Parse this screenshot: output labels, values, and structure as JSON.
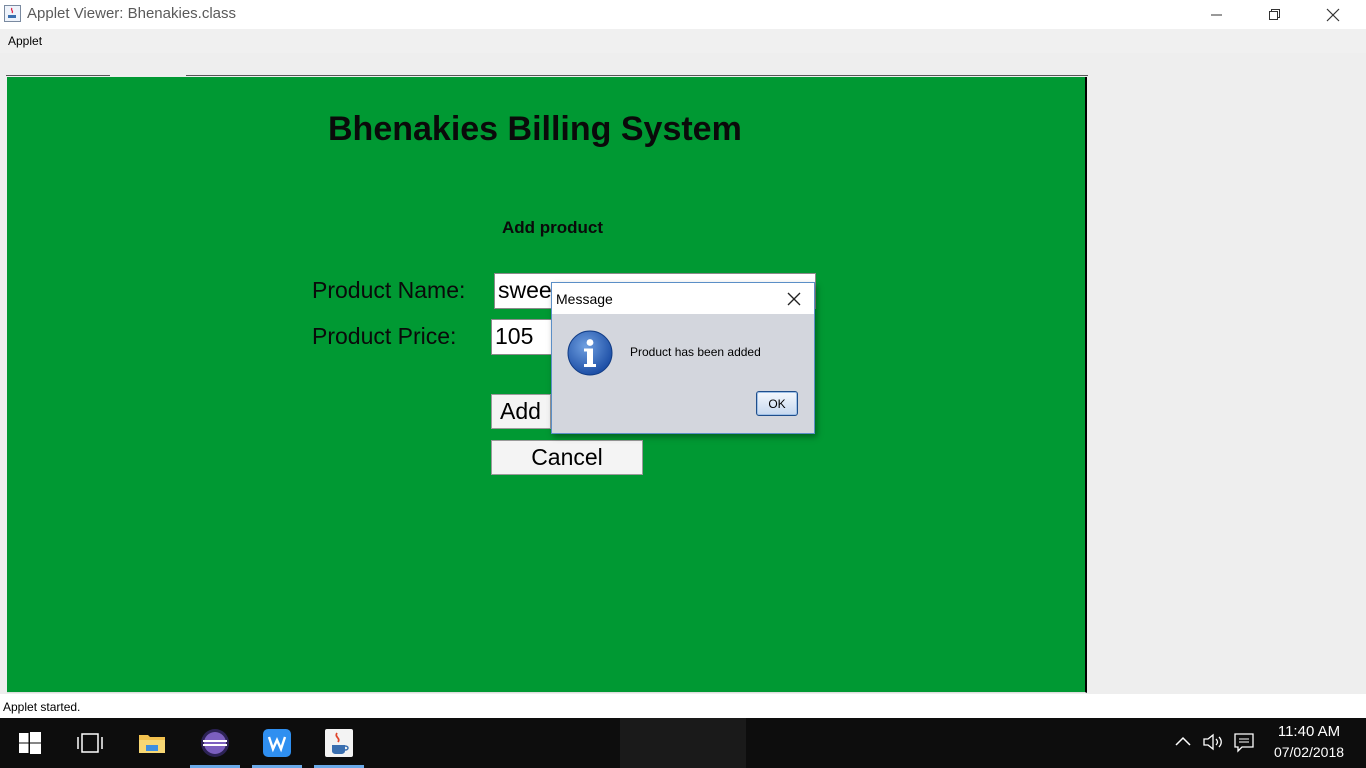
{
  "window": {
    "title": "Applet Viewer: Bhenakies.class",
    "menu": [
      "Applet"
    ]
  },
  "applet": {
    "title": "Bhenakies Billing System",
    "subtitle": "Add product",
    "product_name_label": "Product Name:",
    "product_name_value": "swee",
    "product_price_label": "Product Price:",
    "product_price_value": "105",
    "add_label": "Add",
    "cancel_label": "Cancel",
    "background_color": "#009933"
  },
  "dialog": {
    "title": "Message",
    "message": "Product has been added",
    "ok_label": "OK",
    "icon": "info-icon"
  },
  "status": {
    "text": "Applet started."
  },
  "taskbar": {
    "items": [
      "windows-start-icon",
      "task-view-icon",
      "file-explorer-icon",
      "eclipse-icon",
      "wps-writer-icon",
      "java-icon"
    ],
    "time": "11:40 AM",
    "date": "07/02/2018"
  }
}
